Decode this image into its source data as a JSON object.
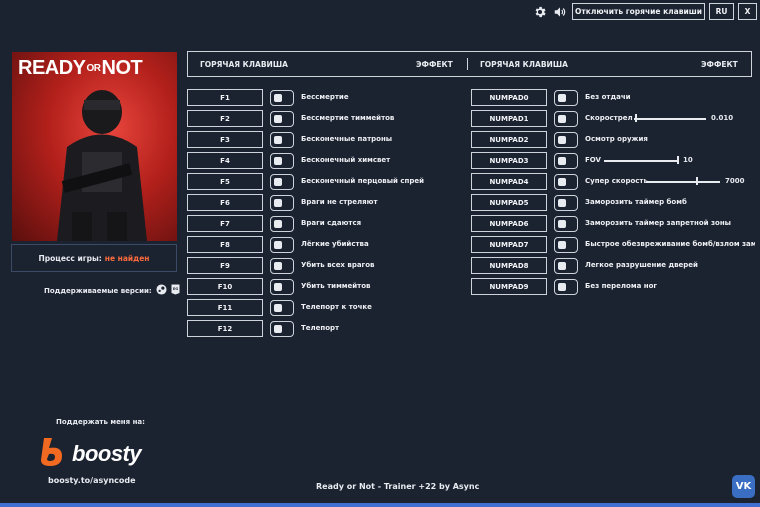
{
  "window": {
    "disable_hotkeys_label": "Отключить горячие клавиши",
    "lang_label": "RU",
    "close_label": "X",
    "settings_icon": "gear-icon",
    "sound_icon": "speaker-icon"
  },
  "game": {
    "cover_title_left": "READY",
    "cover_title_mid": "OR",
    "cover_title_right": "NOT",
    "process_label": "Процесс игры:",
    "process_status": "не найден",
    "versions_label": "Поддерживаемые версии:"
  },
  "table_header": {
    "hotkey_left": "ГОРЯЧАЯ КЛАВИША",
    "effect_left": "ЭФФЕКТ",
    "hotkey_right": "ГОРЯЧАЯ КЛАВИША",
    "effect_right": "ЭФФЕКТ"
  },
  "left_cheats": [
    {
      "key": "F1",
      "label": "Бессмертие"
    },
    {
      "key": "F2",
      "label": "Бессмертие тиммейтов"
    },
    {
      "key": "F3",
      "label": "Бесконечные патроны"
    },
    {
      "key": "F4",
      "label": "Бесконечный химсвет"
    },
    {
      "key": "F5",
      "label": "Бесконечный перцовый спрей"
    },
    {
      "key": "F6",
      "label": "Враги не стреляют"
    },
    {
      "key": "F7",
      "label": "Враги сдаются"
    },
    {
      "key": "F8",
      "label": "Лёгкие убийства"
    },
    {
      "key": "F9",
      "label": "Убить всех врагов"
    },
    {
      "key": "F10",
      "label": "Убить тиммейтов"
    },
    {
      "key": "F11",
      "label": "Телепорт к точке"
    },
    {
      "key": "F12",
      "label": "Телепорт"
    }
  ],
  "right_cheats": [
    {
      "key": "NUMPAD0",
      "label": "Без отдачи"
    },
    {
      "key": "NUMPAD1",
      "label": "Скорострел",
      "value": "0.010",
      "level": 0.02
    },
    {
      "key": "NUMPAD2",
      "label": "Осмотр оружия"
    },
    {
      "key": "NUMPAD3",
      "label": "FOV",
      "value": "10",
      "level": 1.0
    },
    {
      "key": "NUMPAD4",
      "label": "Супер скорость",
      "value": "7000",
      "level": 0.7
    },
    {
      "key": "NUMPAD5",
      "label": "Заморозить таймер бомб"
    },
    {
      "key": "NUMPAD6",
      "label": "Заморозить таймер запретной зоны"
    },
    {
      "key": "NUMPAD7",
      "label": "Быстрое обезвреживание бомб/взлом замков"
    },
    {
      "key": "NUMPAD8",
      "label": "Легкое разрушение дверей"
    },
    {
      "key": "NUMPAD9",
      "label": "Без перелома ног"
    }
  ],
  "support": {
    "title": "Поддержать меня на:",
    "brand": "boosty",
    "url": "boosty.to/asyncode"
  },
  "footer": {
    "title": "Ready or Not - Trainer +22 by Async",
    "vk_label": "VK"
  }
}
